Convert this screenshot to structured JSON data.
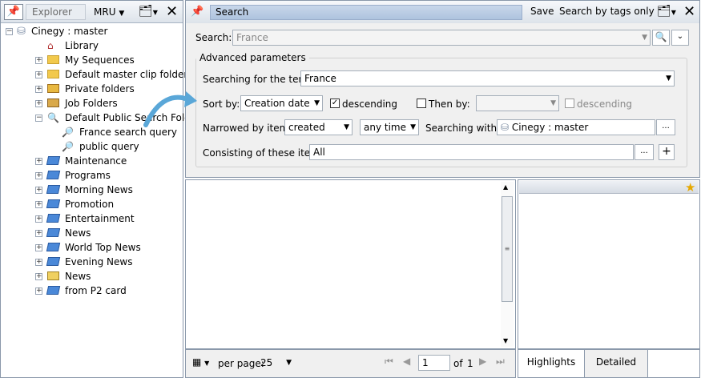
{
  "explorer": {
    "tab_label": "Explorer",
    "mru_label": "MRU",
    "tree": [
      {
        "label": "Cinegy : master",
        "icon": "database-icon",
        "level": 0,
        "expander": "minus"
      },
      {
        "label": "Library",
        "icon": "library-house-icon",
        "level": 1,
        "expander": ""
      },
      {
        "label": "My Sequences",
        "icon": "folder-icon",
        "level": 1,
        "expander": "plus"
      },
      {
        "label": "Default master clip folder",
        "icon": "folder-icon",
        "level": 1,
        "expander": "plus"
      },
      {
        "label": "Private folders",
        "icon": "private-folder-icon",
        "level": 1,
        "expander": "plus"
      },
      {
        "label": "Job Folders",
        "icon": "job-folder-icon",
        "level": 1,
        "expander": "plus"
      },
      {
        "label": "Default Public Search Folder",
        "icon": "search-folder-icon",
        "level": 1,
        "expander": "minus"
      },
      {
        "label": "France search query",
        "icon": "search-query-icon",
        "level": 2,
        "expander": ""
      },
      {
        "label": "public query",
        "icon": "search-query-icon",
        "level": 2,
        "expander": ""
      },
      {
        "label": "Maintenance",
        "icon": "bin-icon",
        "level": 1,
        "expander": "plus"
      },
      {
        "label": "Programs",
        "icon": "bin-icon",
        "level": 1,
        "expander": "plus"
      },
      {
        "label": "Morning News",
        "icon": "bin-icon",
        "level": 1,
        "expander": "plus"
      },
      {
        "label": "Promotion",
        "icon": "bin-icon",
        "level": 1,
        "expander": "plus"
      },
      {
        "label": "Entertainment",
        "icon": "bin-icon",
        "level": 1,
        "expander": "plus"
      },
      {
        "label": "News",
        "icon": "bin-icon",
        "level": 1,
        "expander": "plus"
      },
      {
        "label": "World Top News",
        "icon": "bin-icon",
        "level": 1,
        "expander": "plus"
      },
      {
        "label": "Evening News",
        "icon": "bin-icon",
        "level": 1,
        "expander": "plus"
      },
      {
        "label": "News",
        "icon": "rundown-icon",
        "level": 1,
        "expander": "plus"
      },
      {
        "label": "from P2 card",
        "icon": "bin-icon",
        "level": 1,
        "expander": "plus"
      }
    ]
  },
  "search_panel": {
    "title": "Search",
    "save_label": "Save",
    "search_by_tags_label": "Search by tags only",
    "search_label": "Search:",
    "search_value": "France",
    "advanced_legend": "Advanced parameters",
    "terms_label": "Searching for the terms:",
    "terms_value": "France",
    "sort_by_label": "Sort by:",
    "sort_by_value": "Creation date",
    "descending_label": "descending",
    "then_by_label": "Then by:",
    "then_by_value": "",
    "descending2_label": "descending",
    "narrowed_label": "Narrowed by items:",
    "narrowed_value": "created",
    "time_value": "any time",
    "within_label": "Searching within:",
    "within_value": "Cinegy : master",
    "consisting_label": "Consisting of these items:",
    "consisting_value": "All",
    "ellipsis": "..."
  },
  "pager": {
    "per_page_label": "per page:",
    "per_page_value": "25",
    "page_value": "1",
    "of_label": "of",
    "total_pages": "1"
  },
  "preview_tabs": [
    "Highlights",
    "Detailed"
  ],
  "colors": {
    "accent": "#aec3de",
    "border": "#8a98aa",
    "bin_blue": "#3a78c8",
    "folder_yellow": "#f2c94c"
  }
}
